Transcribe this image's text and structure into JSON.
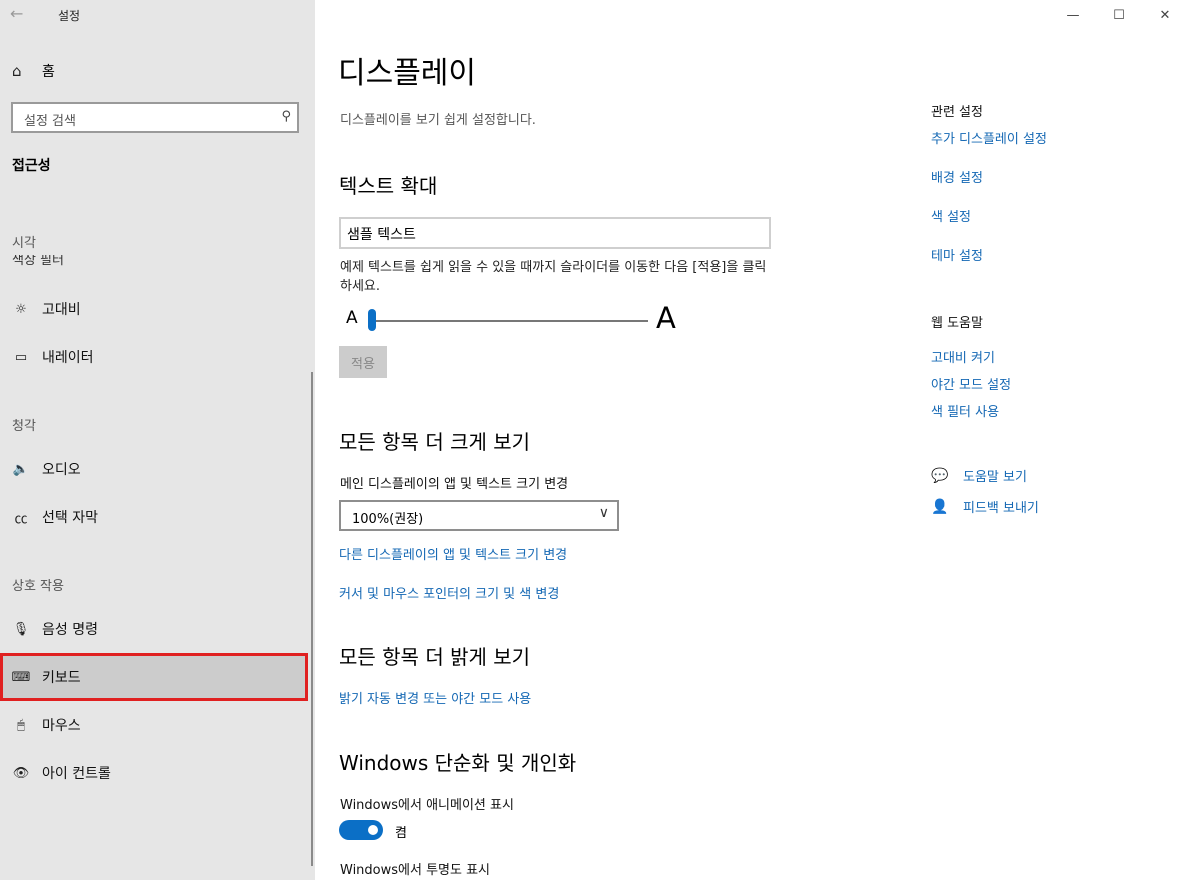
{
  "titlebar": {
    "back_icon": "←",
    "title": "설정"
  },
  "window_controls": {
    "minimize": "—",
    "maximize": "☐",
    "close": "✕"
  },
  "sidebar": {
    "home": {
      "icon": "⌂",
      "label": "홈"
    },
    "search_placeholder": "설정 검색",
    "search_icon": "⚲",
    "section_title": "접근성",
    "groups": {
      "vision": "시각",
      "hearing": "청각",
      "interaction": "상호 작용"
    },
    "partial_item": "색상 필터",
    "items": [
      {
        "icon": "☼",
        "label": "고대비"
      },
      {
        "icon": "▭",
        "label": "내레이터"
      },
      {
        "icon": "🔈",
        "label": "오디오"
      },
      {
        "icon": "㏄",
        "label": "선택 자막"
      },
      {
        "icon": "🎙",
        "label": "음성 명령"
      },
      {
        "icon": "⌨",
        "label": "키보드"
      },
      {
        "icon": "🖱",
        "label": "마우스"
      },
      {
        "icon": "👁",
        "label": "아이 컨트롤"
      }
    ]
  },
  "main": {
    "title": "디스플레이",
    "subtitle": "디스플레이를 보기 쉽게 설정합니다.",
    "text_zoom": {
      "heading": "텍스트 확대",
      "sample": "샘플 텍스트",
      "description": "예제 텍스트를 쉽게 읽을 수 있을 때까지 슬라이더를 이동한 다음 [적용]을 클릭하세요.",
      "small_a": "A",
      "large_a": "A",
      "apply": "적용"
    },
    "bigger": {
      "heading": "모든 항목 더 크게 보기",
      "label": "메인 디스플레이의 앱 및 텍스트 크기 변경",
      "dropdown_value": "100%(권장)",
      "dropdown_icon": "∨",
      "link1": "다른 디스플레이의 앱 및 텍스트 크기 변경",
      "link2": "커서 및 마우스 포인터의 크기 및 색 변경"
    },
    "brighter": {
      "heading": "모든 항목 더 밝게 보기",
      "link": "밝기 자동 변경 또는 야간 모드 사용"
    },
    "simplify": {
      "heading": "Windows 단순화 및 개인화",
      "animation_label": "Windows에서 애니메이션 표시",
      "toggle_state": "켬",
      "transparency_label": "Windows에서 투명도 표시"
    }
  },
  "right": {
    "related_title": "관련 설정",
    "related_links": [
      "추가 디스플레이 설정",
      "배경 설정",
      "색 설정",
      "테마 설정"
    ],
    "web_help_title": "웹 도움말",
    "web_help_links": [
      "고대비 켜기",
      "야간 모드 설정",
      "색 필터 사용"
    ],
    "get_help": {
      "icon": "💬",
      "label": "도움말 보기"
    },
    "feedback": {
      "icon": "👤",
      "label": "피드백 보내기"
    }
  },
  "colors": {
    "accent": "#0b6fc6",
    "link": "#1568b4",
    "sidebar_bg": "#e6e6e6",
    "highlight_border": "#e02020"
  }
}
